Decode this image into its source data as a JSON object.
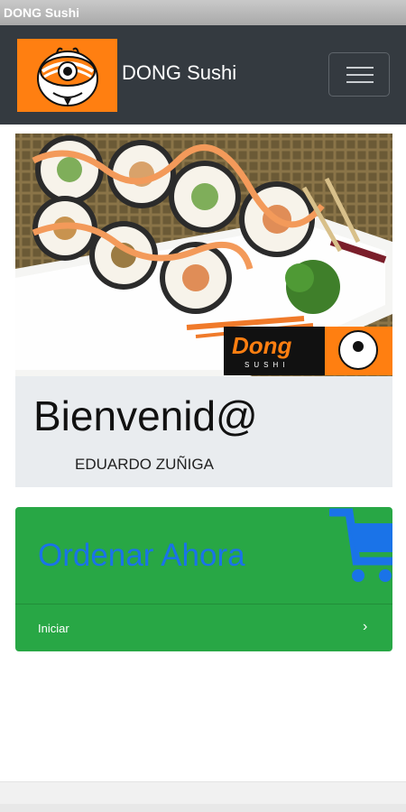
{
  "window": {
    "title": "DONG Sushi"
  },
  "navbar": {
    "brand": "DONG Sushi",
    "logo_icon": "cartoon-mascot-icon",
    "menu_icon": "hamburger-menu-icon"
  },
  "hero": {
    "image_desc_icon": "sushi-plate-image",
    "brand_text": "Dong",
    "brand_sub": "SUSHI"
  },
  "welcome": {
    "title": "Bienvenid@",
    "user": "EDUARDO ZUÑIGA"
  },
  "order": {
    "title": "Ordenar Ahora",
    "start_label": "Iniciar",
    "chevron": "›",
    "cart_icon": "shopping-cart-icon"
  },
  "colors": {
    "navbar": "#343a40",
    "accent_orange": "#ff7f11",
    "order_green": "#28a745",
    "order_title_blue": "#1a73e8"
  }
}
